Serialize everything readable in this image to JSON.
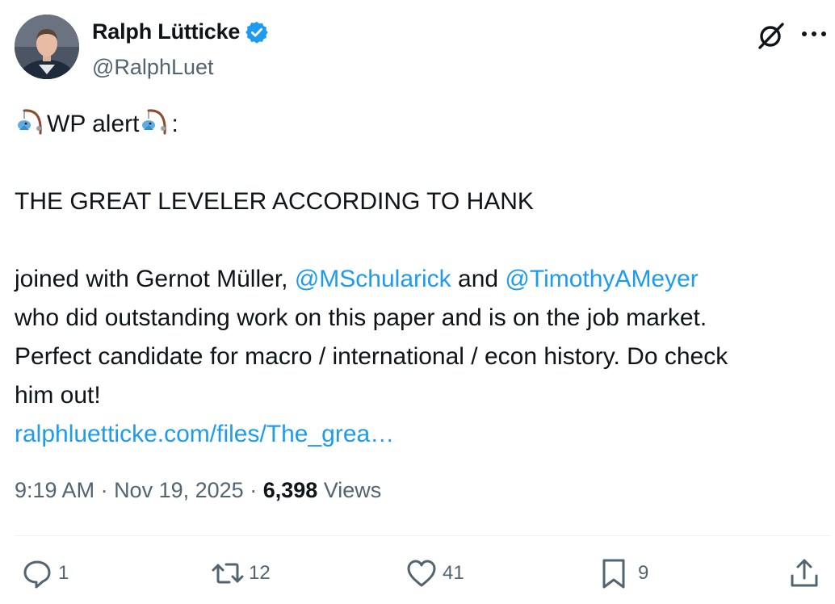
{
  "author": {
    "display_name": "Ralph Lütticke",
    "handle": "@RalphLuet",
    "verified_icon": "verified-badge-icon"
  },
  "header_icons": [
    "grok-icon",
    "more-icon"
  ],
  "tweet": {
    "line1_text": "WP alert",
    "line1_suffix": ":",
    "title": "THE GREAT LEVELER ACCORDING TO HANK",
    "l3_a": "joined with Gernot Müller, ",
    "mention1": "@MSchularick",
    "l3_b": " and ",
    "mention2": "@TimothyAMeyer",
    "l4": "who did outstanding work on this paper and is on the job market.",
    "l5": "Perfect candidate for macro / international / econ history. Do check",
    "l6": "him out!",
    "link": "ralphluetticke.com/files/The_grea…"
  },
  "meta": {
    "time": "9:19 AM",
    "sep1": " · ",
    "date": "Nov 19, 2025",
    "sep2": " · ",
    "views_count": "6,398",
    "views_label": " Views"
  },
  "actions": {
    "reply_count": "1",
    "retweet_count": "12",
    "like_count": "41",
    "bookmark_count": "9"
  },
  "colors": {
    "accent": "#1d9bf0",
    "secondary_text": "#536471",
    "primary_text": "#0f1419"
  }
}
